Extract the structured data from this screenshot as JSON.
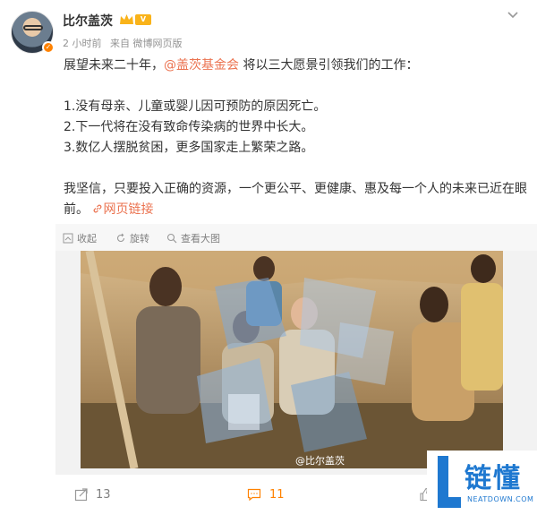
{
  "post": {
    "user_name": "比尔盖茨",
    "time": "2 小时前",
    "source": "来自 微博网页版",
    "lines": {
      "intro_before": "展望未来二十年，",
      "mention": "@盖茨基金会",
      "intro_after": " 将以三大愿景引领我们的工作：",
      "item1": "1.没有母亲、儿童或婴儿因可预防的原因死亡。",
      "item2": "2.下一代将在没有致命传染病的世界中长大。",
      "item3": "3.数亿人摆脱贫困，更多国家走上繁荣之路。",
      "closing": "我坚信，只要投入正确的资源，一个更公平、更健康、惠及每一个人的未来已近在眼前。",
      "web_link": "网页链接"
    }
  },
  "toolbar": {
    "collect": "收起",
    "rotate": "旋转",
    "view_large": "查看大图"
  },
  "media": {
    "watermark": "@比尔盖茨"
  },
  "footer": {
    "shares": "13",
    "comments": "11"
  },
  "brand": {
    "name": "链懂",
    "domain": "NEATDOWN.COM"
  },
  "colors": {
    "accent": "#eb7350",
    "comment_active": "#ff8200",
    "brand_blue": "#1e78d0"
  }
}
